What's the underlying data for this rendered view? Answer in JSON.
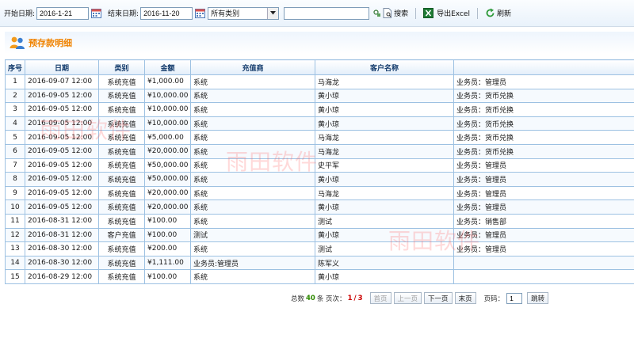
{
  "toolbar": {
    "start_label": "开始日期:",
    "start_value": "2016-1-21",
    "end_label": "结束日期:",
    "end_value": "2016-11-20",
    "category_value": "所有类别",
    "search_value": "",
    "search_label": "搜索",
    "export_label": "导出Excel",
    "refresh_label": "刷新"
  },
  "page_title": "预存款明细",
  "columns": [
    "序号",
    "日期",
    "类别",
    "金额",
    "充值商",
    "客户名称",
    ""
  ],
  "rows": [
    [
      "1",
      "2016-09-07 12:00",
      "系统充值",
      "¥1,000.00",
      "系统",
      "马海龙",
      "业务员：管理员"
    ],
    [
      "2",
      "2016-09-05 12:00",
      "系统充值",
      "¥10,000.00",
      "系统",
      "黄小琼",
      "业务员：货币兑换"
    ],
    [
      "3",
      "2016-09-05 12:00",
      "系统充值",
      "¥10,000.00",
      "系统",
      "黄小琼",
      "业务员：货币兑换"
    ],
    [
      "4",
      "2016-09-05 12:00",
      "系统充值",
      "¥10,000.00",
      "系统",
      "黄小琼",
      "业务员：货币兑换"
    ],
    [
      "5",
      "2016-09-05 12:00",
      "系统充值",
      "¥5,000.00",
      "系统",
      "马海龙",
      "业务员：货币兑换"
    ],
    [
      "6",
      "2016-09-05 12:00",
      "系统充值",
      "¥20,000.00",
      "系统",
      "马海龙",
      "业务员：货币兑换"
    ],
    [
      "7",
      "2016-09-05 12:00",
      "系统充值",
      "¥50,000.00",
      "系统",
      "史平军",
      "业务员：管理员"
    ],
    [
      "8",
      "2016-09-05 12:00",
      "系统充值",
      "¥50,000.00",
      "系统",
      "黄小琼",
      "业务员：管理员"
    ],
    [
      "9",
      "2016-09-05 12:00",
      "系统充值",
      "¥20,000.00",
      "系统",
      "马海龙",
      "业务员：管理员"
    ],
    [
      "10",
      "2016-09-05 12:00",
      "系统充值",
      "¥20,000.00",
      "系统",
      "黄小琼",
      "业务员：管理员"
    ],
    [
      "11",
      "2016-08-31 12:00",
      "系统充值",
      "¥100.00",
      "系统",
      "测试",
      "业务员：销售部"
    ],
    [
      "12",
      "2016-08-31 12:00",
      "客户充值",
      "¥100.00",
      "测试",
      "黄小琼",
      "业务员：管理员"
    ],
    [
      "13",
      "2016-08-30 12:00",
      "系统充值",
      "¥200.00",
      "系统",
      "测试",
      "业务员：管理员"
    ],
    [
      "14",
      "2016-08-30 12:00",
      "系统充值",
      "¥1,111.00",
      "业务员:管理员",
      "陈军义",
      ""
    ],
    [
      "15",
      "2016-08-29 12:00",
      "系统充值",
      "¥100.00",
      "系统",
      "黄小琼",
      ""
    ]
  ],
  "pager": {
    "total_prefix": "总数",
    "total": "40",
    "total_suffix": "条 页次：",
    "current": "1",
    "sep": "/",
    "pages": "3",
    "first": "首页",
    "prev": "上一页",
    "next": "下一页",
    "last": "末页",
    "page_label": "页码：",
    "page_value": "1",
    "go": "跳转"
  },
  "watermark": "雨田软件",
  "colors": {
    "title": "#f08300",
    "border": "#9dc1e2",
    "header_text": "#123a6b"
  }
}
